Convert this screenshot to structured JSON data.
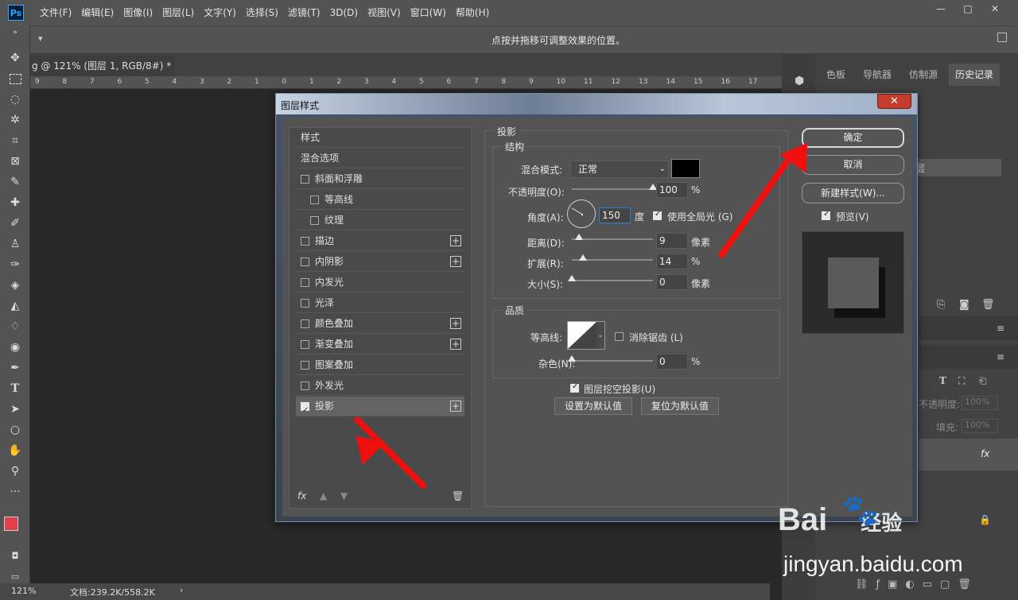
{
  "menubar": {
    "logo": "Ps",
    "items": [
      "文件(F)",
      "编辑(E)",
      "图像(I)",
      "图层(L)",
      "文字(Y)",
      "选择(S)",
      "滤镜(T)",
      "3D(D)",
      "视图(V)",
      "窗口(W)",
      "帮助(H)"
    ],
    "window_controls": [
      "—",
      "□",
      "✕"
    ]
  },
  "optionsbar": {
    "hint": "点按并拖移可调整效果的位置。"
  },
  "document": {
    "tab_label": "g @ 121% (图层 1, RGB/8#) *",
    "tab_close": "✕",
    "ruler_numbers": [
      "9",
      "8",
      "7",
      "6",
      "5",
      "4",
      "3",
      "2",
      "1",
      "0",
      "1",
      "2",
      "3",
      "4",
      "5",
      "6",
      "7",
      "8",
      "9",
      "10",
      "11",
      "12",
      "13",
      "14",
      "15",
      "16",
      "17"
    ],
    "zoom": "121%",
    "doc_info": "文档:239.2K/558.2K",
    "status_arrow": "›"
  },
  "right_panel": {
    "tabs": [
      "色板",
      "导航器",
      "仿制源",
      "历史记录"
    ],
    "active_tab": "历史记录",
    "history_item": "层",
    "opacity_label": "不透明度:",
    "opacity_value": "100%",
    "fill_label": "填充:",
    "fill_value": "100%",
    "fx_label": "fx"
  },
  "dialog": {
    "title": "图层样式",
    "close": "✕",
    "styles": [
      {
        "label": "样式",
        "check": false,
        "indent": 0,
        "has_checkbox": false,
        "plus": false
      },
      {
        "label": "混合选项",
        "check": false,
        "indent": 0,
        "has_checkbox": false,
        "plus": false
      },
      {
        "label": "斜面和浮雕",
        "check": false,
        "indent": 0,
        "has_checkbox": true,
        "plus": false
      },
      {
        "label": "等高线",
        "check": false,
        "indent": 1,
        "has_checkbox": true,
        "plus": false
      },
      {
        "label": "纹理",
        "check": false,
        "indent": 1,
        "has_checkbox": true,
        "plus": false
      },
      {
        "label": "描边",
        "check": false,
        "indent": 0,
        "has_checkbox": true,
        "plus": true
      },
      {
        "label": "内阴影",
        "check": false,
        "indent": 0,
        "has_checkbox": true,
        "plus": true
      },
      {
        "label": "内发光",
        "check": false,
        "indent": 0,
        "has_checkbox": true,
        "plus": false
      },
      {
        "label": "光泽",
        "check": false,
        "indent": 0,
        "has_checkbox": true,
        "plus": false
      },
      {
        "label": "颜色叠加",
        "check": false,
        "indent": 0,
        "has_checkbox": true,
        "plus": true
      },
      {
        "label": "渐变叠加",
        "check": false,
        "indent": 0,
        "has_checkbox": true,
        "plus": true
      },
      {
        "label": "图案叠加",
        "check": false,
        "indent": 0,
        "has_checkbox": true,
        "plus": false
      },
      {
        "label": "外发光",
        "check": false,
        "indent": 0,
        "has_checkbox": true,
        "plus": false
      },
      {
        "label": "投影",
        "check": true,
        "indent": 0,
        "has_checkbox": true,
        "plus": true,
        "selected": true
      }
    ],
    "list_footer_fx": "fx",
    "section_title": "投影",
    "structure_title": "结构",
    "blend_mode_label": "混合模式:",
    "blend_mode_value": "正常",
    "shadow_color": "#000000",
    "opacity_label": "不透明度(O):",
    "opacity_value": "100",
    "opacity_fraction": 1.0,
    "percent": "%",
    "angle_label": "角度(A):",
    "angle_value": "150",
    "angle_unit": "度",
    "global_light_label": "使用全局光 (G)",
    "global_light_checked": true,
    "distance_label": "距离(D):",
    "distance_value": "9",
    "distance_fraction": 0.09,
    "pixels": "像素",
    "spread_label": "扩展(R):",
    "spread_value": "14",
    "spread_fraction": 0.14,
    "size_label": "大小(S):",
    "size_value": "0",
    "size_fraction": 0.0,
    "quality_title": "品质",
    "contour_label": "等高线:",
    "antialias_label": "消除锯齿 (L)",
    "antialias_checked": false,
    "noise_label": "杂色(N):",
    "noise_value": "0",
    "noise_fraction": 0.0,
    "knockout_label": "图层挖空投影(U)",
    "knockout_checked": true,
    "set_default": "设置为默认值",
    "reset_default": "复位为默认值",
    "ok": "确定",
    "cancel": "取消",
    "new_style": "新建样式(W)...",
    "preview_label": "预览(V)",
    "preview_checked": true
  },
  "watermark": {
    "brand": "Bai",
    "brand_cn": "经验",
    "url": "jingyan.baidu.com"
  },
  "colors": {
    "foreground": "#e0404a",
    "background": "#ffffff",
    "annotation_arrow": "#f00f0f"
  }
}
